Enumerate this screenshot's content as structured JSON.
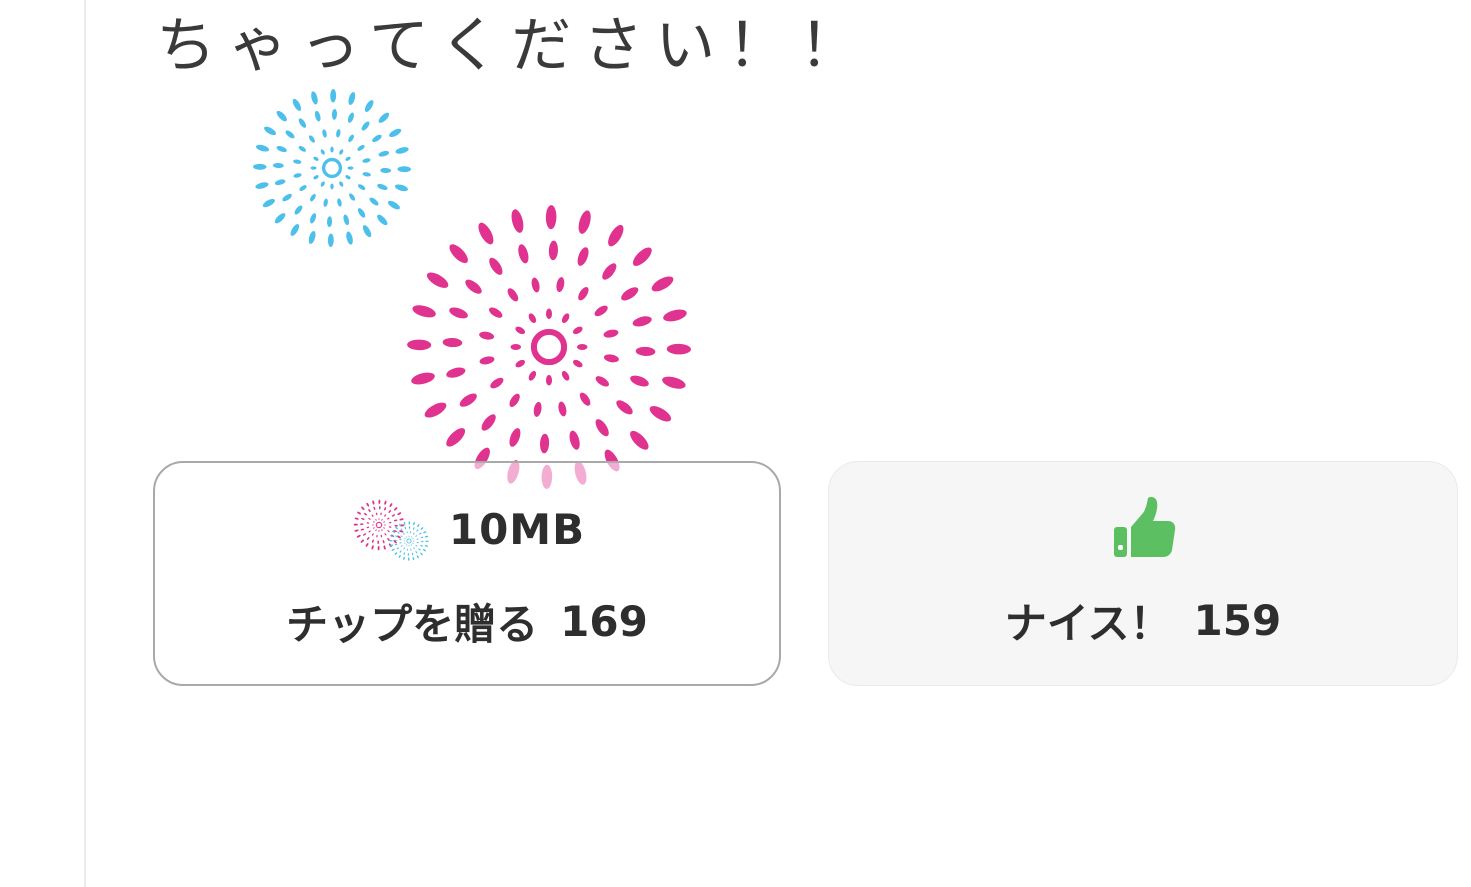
{
  "message": {
    "text": "ちゃってください！！"
  },
  "colors": {
    "firework_pink": "#e0338f",
    "firework_blue": "#4cc0ea",
    "thumb_green": "#5cc063"
  },
  "tip_button": {
    "icon": "fireworks-icon",
    "amount": "10MB",
    "label": "チップを贈る",
    "count": "169"
  },
  "nice_button": {
    "icon": "thumbs-up-icon",
    "label": "ナイス！",
    "count": "159"
  }
}
